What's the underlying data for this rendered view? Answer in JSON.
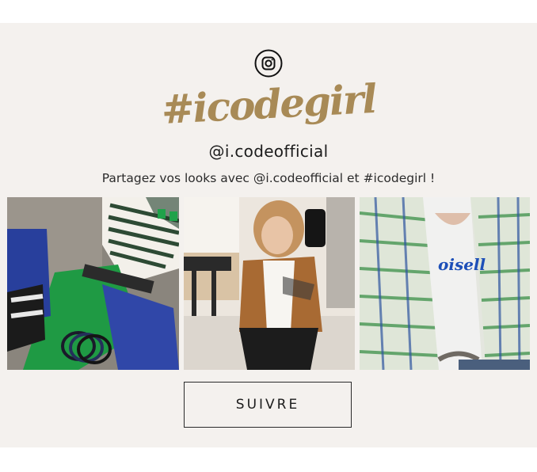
{
  "instagram": {
    "icon": "instagram-icon",
    "hashtag": "#icodegirl",
    "handle": "@i.codeofficial",
    "tagline": "Partagez vos looks avec @i.codeofficial et #icodegirl  !"
  },
  "photos": [
    {
      "subject": "flat-lay-outfit-photo"
    },
    {
      "subject": "mirror-selfie-photo"
    },
    {
      "subject": "tweed-jacket-photo"
    }
  ],
  "photo_caption_text": "oisell",
  "follow_button": {
    "label": "SUIVRE"
  },
  "colors": {
    "background": "#f4f1ee",
    "hashtag": "#a88a56",
    "text": "#1c1c1c"
  }
}
